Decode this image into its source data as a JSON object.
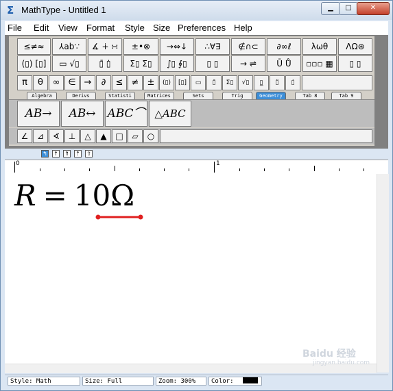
{
  "window": {
    "title": "MathType - Untitled 1",
    "minimize": "▁",
    "maximize": "□",
    "close": "✕",
    "app_icon": "Σ"
  },
  "menu": [
    "File",
    "Edit",
    "View",
    "Format",
    "Style",
    "Size",
    "Preferences",
    "Help"
  ],
  "toolbar": {
    "row1": [
      "≤≠≈",
      "⅄ab∵",
      "∡ ∔ ∺",
      "±•⊗",
      "→⇔↓",
      "∴∀∃",
      "∉∩⊂",
      "∂∞ℓ",
      "λωθ",
      "ΛΩ⊛"
    ],
    "row2": [
      "(▯) [▯]",
      "▭ √▯",
      "▯̄ ▯̇",
      "Σ▯ Σ▯",
      "∫▯ ∮▯",
      "▯ ▯",
      "→ ⇌",
      "Ū Ů",
      "▫▫▫ ▦",
      "▯ ▯"
    ],
    "row3": [
      "π",
      "θ",
      "∞",
      "∈",
      "→",
      "∂",
      "≤",
      "≠",
      "±",
      "(▯)",
      "[▯]",
      "▭",
      "▯̄",
      "Σ▯",
      "√▯",
      "▯̲",
      "▯̈",
      "▯̇"
    ]
  },
  "tabs": [
    "Algebra",
    "Derivs",
    "Statisti",
    "Matrices",
    "Sets",
    "Trig",
    "Geometry",
    "Tab 8",
    "Tab 9"
  ],
  "active_tab": "Geometry",
  "templates": [
    "AB→",
    "AB↔",
    "ABC⌒",
    "△ABC"
  ],
  "geometry_symbols": [
    "∠",
    "⊿",
    "∢",
    "⊥",
    "△",
    "▲",
    "□",
    "▱",
    "○"
  ],
  "strip_buttons": [
    "↰",
    "↑",
    "⇑",
    "⇡",
    "⇧"
  ],
  "ruler": {
    "mark0": "0",
    "mark1": "1"
  },
  "equation": {
    "lhs": "R",
    "eq": "=",
    "value": "10",
    "unit": "Ω"
  },
  "status": {
    "style": "Style: Math",
    "size": "Size: Full",
    "zoom": "Zoom: 300%",
    "color": "Color:"
  },
  "colors": {
    "accent": "#3c8ed8",
    "mark": "#e02020",
    "swatch": "#000000"
  },
  "watermark": {
    "main": "Baidu 经验",
    "sub": "jingyan.baidu.com"
  }
}
